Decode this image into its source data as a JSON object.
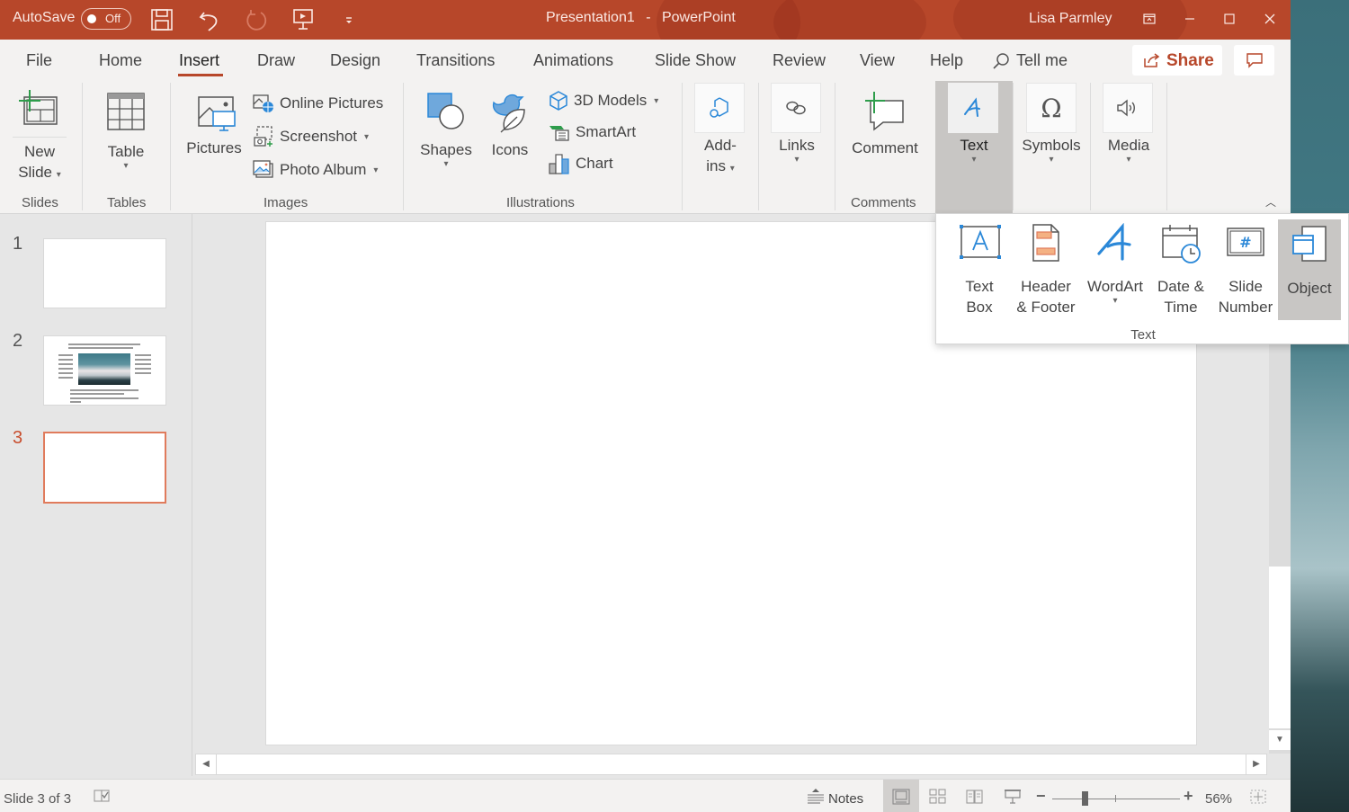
{
  "titlebar": {
    "autosave_label": "AutoSave",
    "autosave_state": "Off",
    "document_title": "Presentation1",
    "separator": "-",
    "app_name": "PowerPoint",
    "user_name": "Lisa Parmley",
    "quick_access": [
      "save-icon",
      "undo-icon",
      "redo-icon",
      "start-from-beginning-icon",
      "customize-qat-icon"
    ],
    "window_controls": [
      "ribbon-display-options-icon",
      "minimize-icon",
      "maximize-icon",
      "close-icon"
    ]
  },
  "tabs": {
    "items": [
      {
        "label": "File"
      },
      {
        "label": "Home"
      },
      {
        "label": "Insert",
        "active": true
      },
      {
        "label": "Draw"
      },
      {
        "label": "Design"
      },
      {
        "label": "Transitions"
      },
      {
        "label": "Animations"
      },
      {
        "label": "Slide Show"
      },
      {
        "label": "Review"
      },
      {
        "label": "View"
      },
      {
        "label": "Help"
      }
    ],
    "tell_me": "Tell me",
    "share_label": "Share"
  },
  "ribbon": {
    "groups": {
      "slides": {
        "label": "Slides",
        "new_slide_line1": "New",
        "new_slide_line2": "Slide"
      },
      "tables": {
        "label": "Tables",
        "table": "Table"
      },
      "images": {
        "label": "Images",
        "pictures": "Pictures",
        "online_pictures": "Online Pictures",
        "screenshot": "Screenshot",
        "photo_album": "Photo Album"
      },
      "illustrations": {
        "label": "Illustrations",
        "shapes": "Shapes",
        "icons": "Icons",
        "models_3d": "3D Models",
        "smartart": "SmartArt",
        "chart": "Chart"
      },
      "addins": {
        "line1": "Add-",
        "line2": "ins"
      },
      "links": {
        "label": "Links"
      },
      "comments": {
        "label": "Comments",
        "comment": "Comment"
      },
      "text": {
        "label": "Text"
      },
      "symbols": {
        "label": "Symbols"
      },
      "media": {
        "label": "Media"
      }
    },
    "caret": "▾"
  },
  "text_dropdown": {
    "group_label": "Text",
    "items": [
      {
        "line1": "Text",
        "line2": "Box"
      },
      {
        "line1": "Header",
        "line2": "& Footer"
      },
      {
        "line1": "WordArt",
        "line2": ""
      },
      {
        "line1": "Date &",
        "line2": "Time"
      },
      {
        "line1": "Slide",
        "line2": "Number"
      },
      {
        "line1": "Object",
        "line2": "",
        "hovered": true
      }
    ]
  },
  "slides": {
    "thumbnails": [
      {
        "number": "1",
        "selected": false
      },
      {
        "number": "2",
        "selected": false,
        "has_image": true
      },
      {
        "number": "3",
        "selected": true
      }
    ]
  },
  "statusbar": {
    "slide_position": "Slide 3 of 3",
    "notes_label": "Notes",
    "zoom_percent": "56%",
    "zoom_level": 56
  },
  "colors": {
    "accent": "#b7472a",
    "selected_thumb_border": "#e07b5c",
    "icon_blue": "#2b88d8"
  }
}
